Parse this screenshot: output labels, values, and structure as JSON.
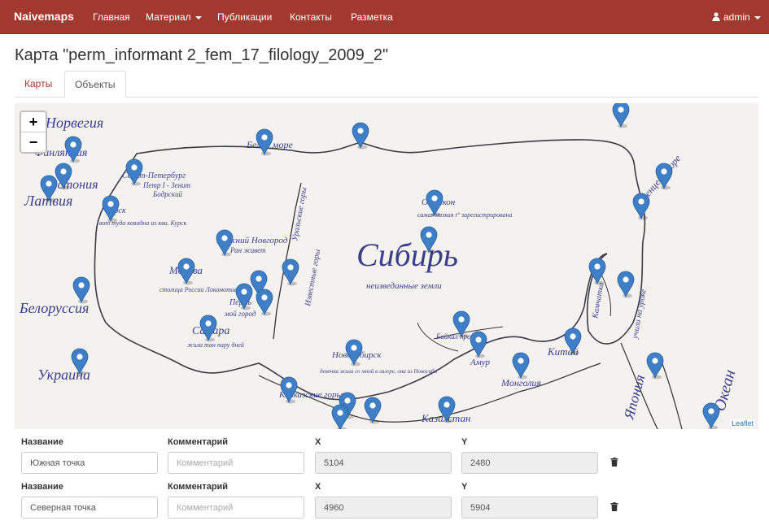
{
  "navbar": {
    "brand": "Naivemaps",
    "items": [
      "Главная",
      "Материал",
      "Публикации",
      "Контакты",
      "Разметка"
    ],
    "user": "admin",
    "color": "#a3392e"
  },
  "page": {
    "title": "Карта \"perm_informant 2_fem_17_filology_2009_2\""
  },
  "tabs": [
    {
      "label": "Карты",
      "active": false
    },
    {
      "label": "Объекты",
      "active": true
    }
  ],
  "map": {
    "zoom_in": "+",
    "zoom_out": "−",
    "attribution": "Leaflet",
    "marker_color": "#3f7fc7",
    "handwritten_labels": [
      "Норвегия",
      "Финляндия",
      "Эстония",
      "Латвия",
      "Белоруссия",
      "Украина",
      "Санкт-Петербург",
      "Петр I - Зенит",
      "Бодрский",
      "Курск",
      "вот туда ковидна из кви. Курск",
      "Нижний Новгород",
      "Ран живет",
      "Москва",
      "столица России Локомотив",
      "Пермь",
      "мой город",
      "Самара",
      "жила тан пару дней",
      "Уральские горы",
      "Известные горы",
      "Баренцево море",
      "Белое море",
      "Сибирь",
      "неизведанные земли",
      "Оймякон",
      "самая низкая t° зарегистрирована",
      "Новосибирск",
      "девочка жила со мной в лагере, она из Новосиба",
      "Кавказские горы",
      "Казахстан",
      "Байкал пресное",
      "Амур",
      "Монголия",
      "Китай",
      "Япония",
      "Камчатка",
      "учили на уроке",
      "Океан"
    ]
  },
  "objects": {
    "headers": {
      "name": "Название",
      "comment": "Комментарий",
      "x": "X",
      "y": "Y"
    },
    "comment_placeholder": "Комментарий",
    "rows": [
      {
        "name": "Южная точка",
        "comment": "",
        "x": "5104",
        "y": "2480"
      },
      {
        "name": "Северная точка",
        "comment": "",
        "x": "4960",
        "y": "5904"
      }
    ]
  }
}
